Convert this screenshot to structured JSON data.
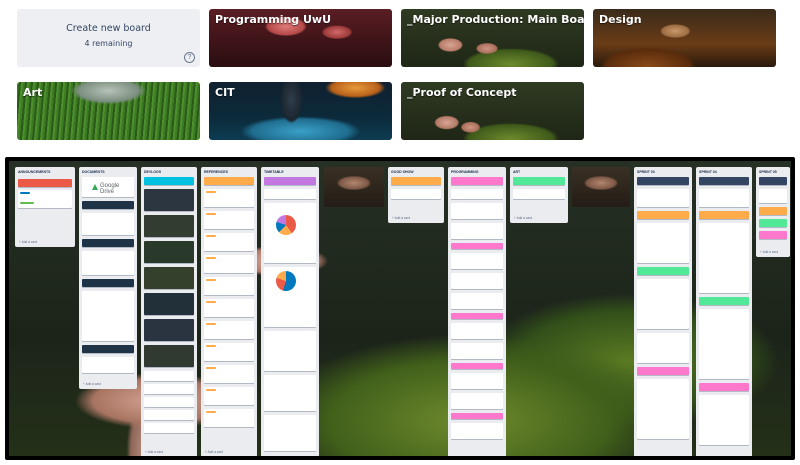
{
  "boards": {
    "create": {
      "title": "Create new board",
      "remaining": "4 remaining",
      "help_icon": "help-circle-icon"
    },
    "items": [
      {
        "title": "Programming UwU"
      },
      {
        "title": "_Major Production: Main Board"
      },
      {
        "title": "Design"
      },
      {
        "title": "Art"
      },
      {
        "title": "CIT"
      },
      {
        "title": "_Proof of Concept"
      }
    ]
  },
  "preview": {
    "lists": [
      {
        "name": "ANNOUNCEMENTS"
      },
      {
        "name": "DOCUMENTS"
      },
      {
        "name": "DEVLOGS"
      },
      {
        "name": "REFERENCES"
      },
      {
        "name": "TIMETABLE"
      },
      {
        "name": "GOOD SHOW"
      },
      {
        "name": "PROGRAMMING"
      },
      {
        "name": "ART"
      },
      {
        "name": "SPRINT 03"
      },
      {
        "name": "SPRINT 04"
      },
      {
        "name": "SPRINT 05"
      }
    ],
    "google_drive": "Google Drive",
    "add_card": "+ Add a card",
    "devlog_prefix": "Dev Log #"
  }
}
